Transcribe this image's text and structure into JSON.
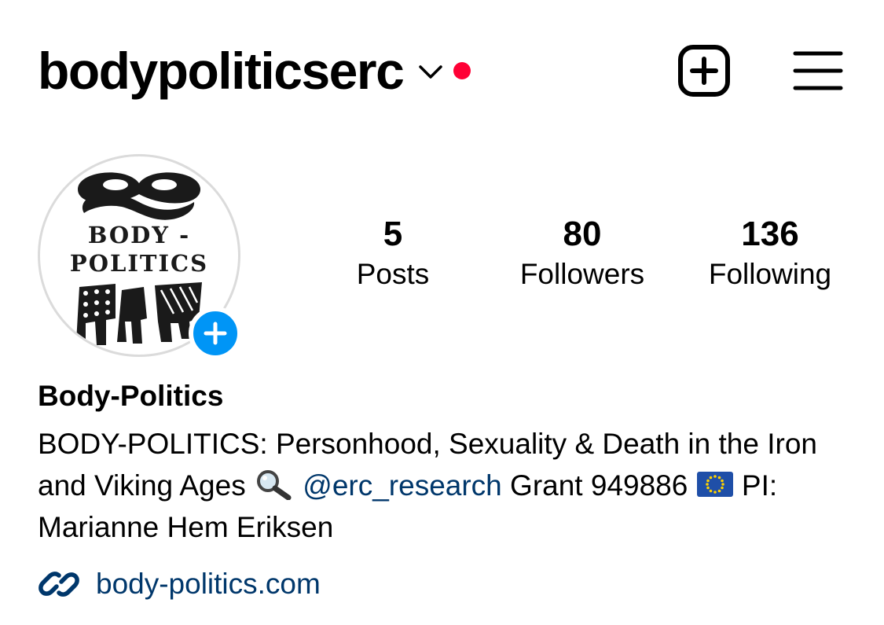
{
  "header": {
    "username": "bodypoliticserc",
    "notification_color": "#ff0035"
  },
  "icons": {
    "chevron": "chevron-down-icon",
    "new_post": "plus-square-icon",
    "menu": "hamburger-menu-icon",
    "add_story": "plus-icon",
    "link": "link-icon"
  },
  "avatar": {
    "logo_line1": "BODY -",
    "logo_line2": "POLITICS"
  },
  "stats": {
    "posts": {
      "value": "5",
      "label": "Posts"
    },
    "followers": {
      "value": "80",
      "label": "Followers"
    },
    "following": {
      "value": "136",
      "label": "Following"
    }
  },
  "profile": {
    "display_name": "Body-Politics",
    "bio_part1": "BODY-POLITICS: Personhood, Sexuality & Death in the Iron and Viking Ages ",
    "bio_mention": "@erc_research",
    "bio_part2": " Grant 949886 ",
    "bio_part3": " PI: Marianne Hem Eriksen",
    "website": "body-politics.com"
  },
  "colors": {
    "link_blue": "#00376b",
    "action_blue": "#0095f6",
    "text": "#000000",
    "avatar_border": "#dbdbdb"
  }
}
